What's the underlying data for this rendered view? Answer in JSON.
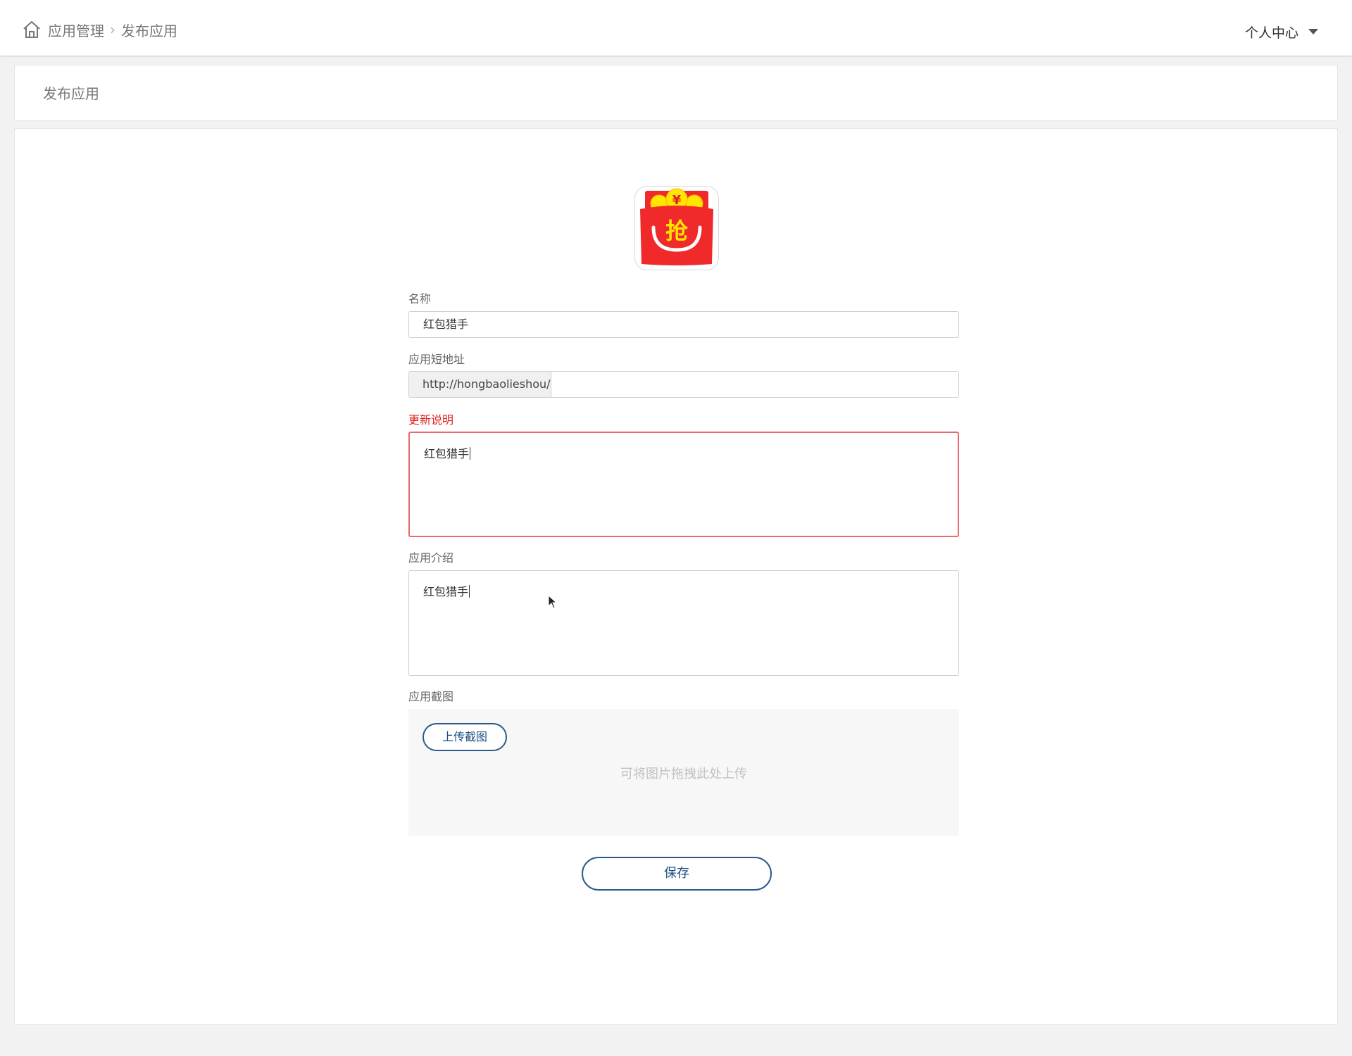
{
  "header": {
    "breadcrumb": [
      "应用管理",
      "发布应用"
    ],
    "user_menu_label": "个人中心"
  },
  "page_title": "发布应用",
  "form": {
    "name_label": "名称",
    "name_value": "红包猎手",
    "short_url_label": "应用短地址",
    "short_url_prefix": "http://hongbaolieshou/",
    "short_url_value": "",
    "release_notes_label": "更新说明",
    "release_notes_value": "红包猎手",
    "intro_label": "应用介绍",
    "intro_value": "红包猎手",
    "screenshots_label": "应用截图",
    "upload_button": "上传截图",
    "drop_hint": "可将图片拖拽此处上传",
    "save_button": "保存"
  },
  "app_icon": {
    "icon": "red-envelope-app-icon",
    "glyph": "抢",
    "coin_glyph": "¥"
  },
  "colors": {
    "accent": "#1e4f82",
    "error": "#e02020",
    "icon_red": "#f02a2a",
    "icon_yellow": "#ffe500"
  }
}
